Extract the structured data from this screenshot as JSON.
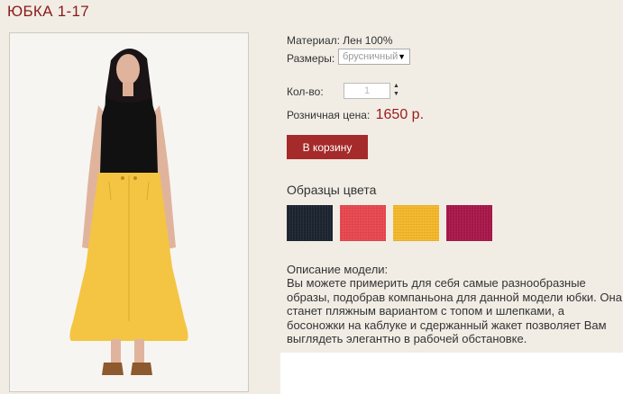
{
  "product": {
    "title": "ЮБКА 1-17",
    "material": "Материал: Лен 100%",
    "sizes_label": "Размеры:",
    "size_selected": "брусничный",
    "qty_label": "Кол-во:",
    "qty_value": "1",
    "price_label": "Розничная цена:",
    "price": "1650 р.",
    "cart_button": "В корзину"
  },
  "swatches": {
    "title": "Образцы цвета",
    "colors": [
      "#1c2430",
      "#e8474e",
      "#f4b82a",
      "#a8174a"
    ]
  },
  "description": {
    "heading": "Описание модели:",
    "text": "Вы можете примерить для себя самые разнообразные образы, подобрав компаньона для данной модели юбки. Она станет пляжным вариантом с топом и шлепками, а босоножки на каблуке и сдержанный жакет позволяет Вам выглядеть элегантно в рабочей обстановке."
  }
}
